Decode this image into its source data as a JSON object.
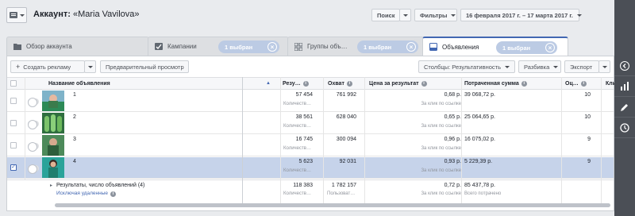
{
  "header": {
    "account_label": "Аккаунт:",
    "account_name": "«Maria Vavilova»",
    "search_label": "Поиск",
    "filters_label": "Фильтры",
    "date_range": "16 февраля 2017 г. – 17 марта 2017 г."
  },
  "tabs": [
    {
      "label": "Обзор аккаунта"
    },
    {
      "label": "Кампании",
      "pill": "1 выбран"
    },
    {
      "label": "Группы объ…",
      "pill": "1 выбран"
    },
    {
      "label": "Объявления",
      "pill": "1 выбран"
    }
  ],
  "toolbar": {
    "create_label": "Создать рекламу",
    "preview_label": "Предварительный просмотр",
    "columns_label": "Столбцы: Результативность",
    "breakdown_label": "Разбивка",
    "export_label": "Экспорт"
  },
  "columns": {
    "name": "Название объявления",
    "results": "Резу…",
    "reach": "Охват",
    "cost": "Цена за результат",
    "spent": "Потраченная сумма",
    "score": "Оц…",
    "clicks": "Кли"
  },
  "rows": [
    {
      "name": "1",
      "results": "57 454",
      "results_sub": "Количеств…",
      "reach": "761 992",
      "cost": "0,68 р.",
      "cost_sub": "За клик по ссылке",
      "spent": "39 068,72 р.",
      "score": "10",
      "selected": false
    },
    {
      "name": "2",
      "results": "38 561",
      "results_sub": "Количеств…",
      "reach": "628 040",
      "cost": "0,65 р.",
      "cost_sub": "За клик по ссылке",
      "spent": "25 064,65 р.",
      "score": "10",
      "selected": false
    },
    {
      "name": "3",
      "results": "16 745",
      "results_sub": "Количеств…",
      "reach": "300 094",
      "cost": "0,96 р.",
      "cost_sub": "За клик по ссылке",
      "spent": "16 075,02 р.",
      "score": "9",
      "selected": false
    },
    {
      "name": "4",
      "results": "5 623",
      "results_sub": "Количеств…",
      "reach": "92 031",
      "cost": "0,93 р.",
      "cost_sub": "За клик по ссылке",
      "spent": "5 229,39 р.",
      "score": "9",
      "selected": true
    }
  ],
  "summary": {
    "label": "Результаты, число объявлений (4)",
    "link": "Исключая удаленные",
    "results": "118 383",
    "results_sub": "Количеств…",
    "reach": "1 782 157",
    "reach_sub": "Пользоват…",
    "cost": "0,72 р.",
    "cost_sub": "За клик по ссылке",
    "spent": "85 437,78 р.",
    "spent_sub": "Всего потрачено"
  },
  "colors": {
    "accent": "#4267b2",
    "selected_row": "#c6d3ea",
    "pill": "#bccbe4"
  },
  "icons": [
    "account-dropdown-icon",
    "folder-icon",
    "campaign-icon",
    "adset-grid-icon",
    "ad-icon",
    "close-icon",
    "info-icon",
    "collapse-panel-icon",
    "chart-icon",
    "pencil-icon",
    "clock-icon"
  ]
}
